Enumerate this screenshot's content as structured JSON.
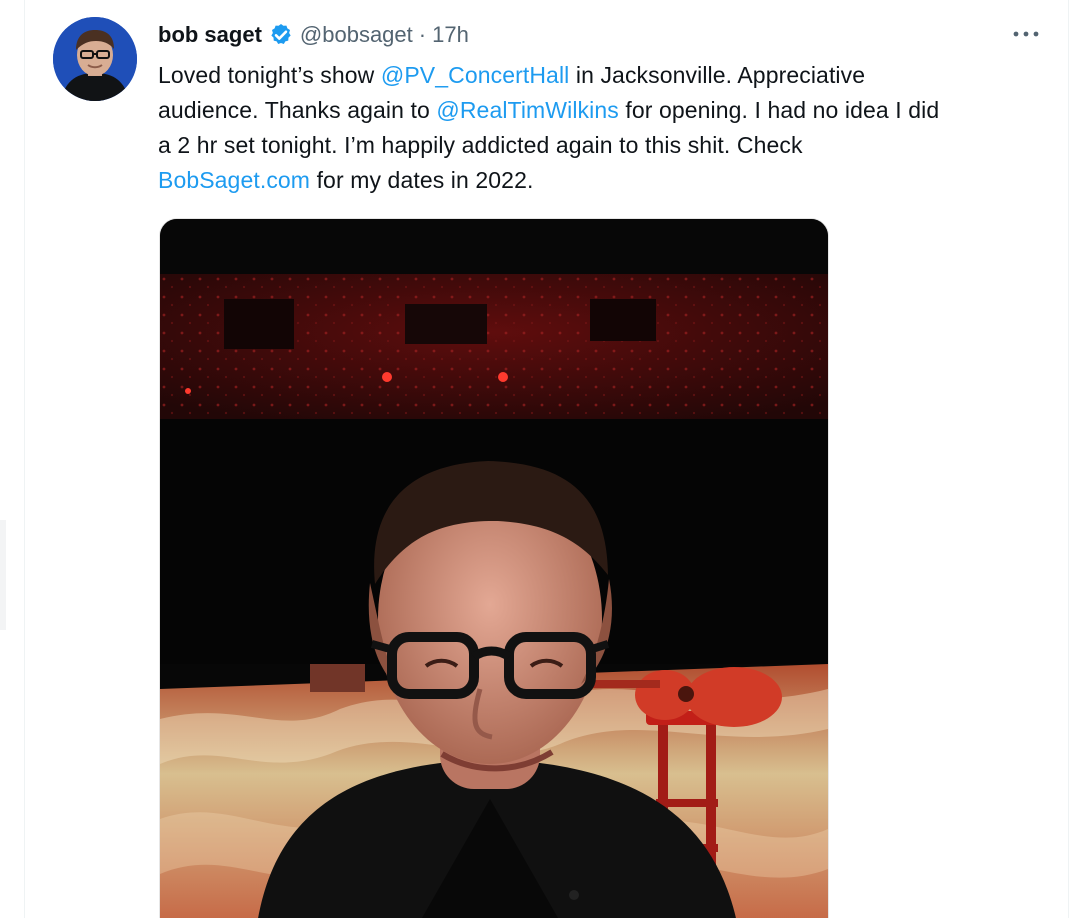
{
  "tweet": {
    "author": {
      "display_name": "bob saget",
      "handle": "@bobsaget",
      "separator": "·",
      "time": "17h",
      "verified": true
    },
    "text": {
      "line1": {
        "before": "Loved tonight’s show ",
        "mention": "@PV_ConcertHall",
        "after": " in Jacksonville. Appreciative"
      },
      "line2": {
        "before": "audience. Thanks again to ",
        "mention": "@RealTimWilkins",
        "after": " for opening. I had no idea I did"
      },
      "line3": {
        "text": "a 2 hr set tonight. I’m happily addicted again to this shit. Check"
      },
      "line4": {
        "link": "BobSaget.com",
        "after": " for my dates in 2022."
      }
    },
    "icons": {
      "avatar": "avatar-image",
      "verified": "verified-badge-icon",
      "more": "more-options-icon",
      "photo": "attached-photo"
    },
    "colors": {
      "text": "#0f1419",
      "secondary": "#536471",
      "link": "#1d9bf0",
      "verified": "#1d9bf0"
    }
  }
}
